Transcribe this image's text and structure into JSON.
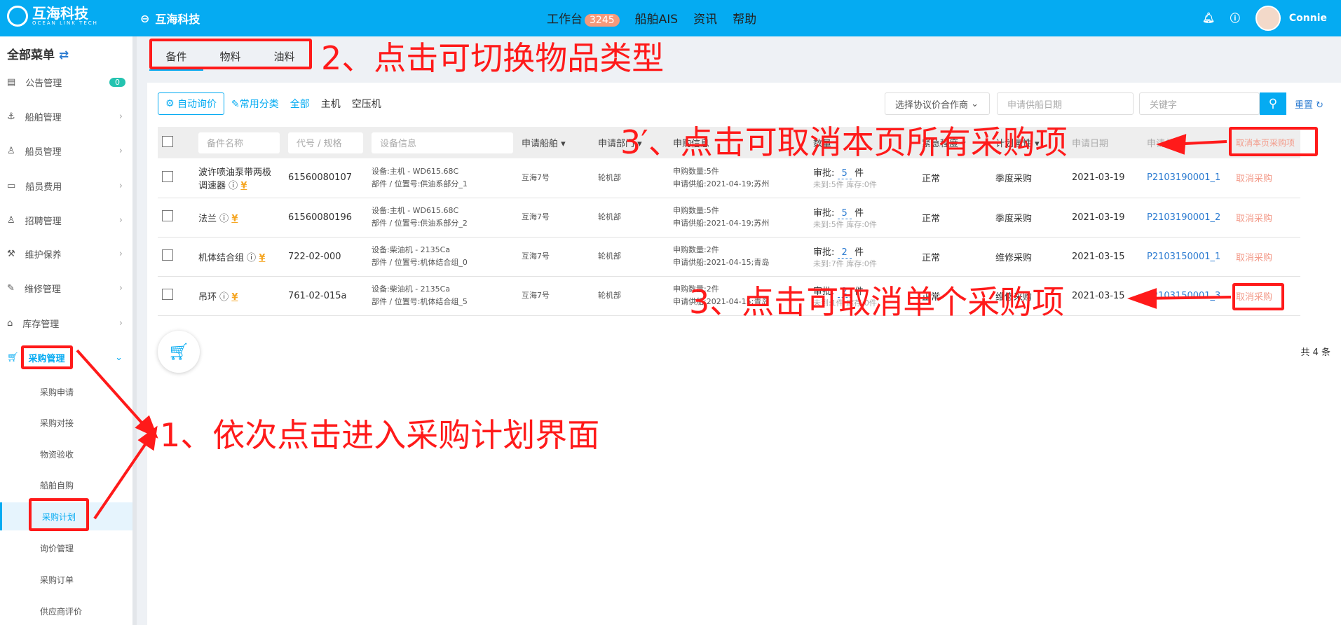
{
  "header": {
    "logo_cn": "互海科技",
    "logo_en": "OCEAN LINK TECH",
    "company": "互海科技",
    "nav": [
      {
        "label": "工作台",
        "badge": "3245"
      },
      {
        "label": "船舶AIS"
      },
      {
        "label": "资讯"
      },
      {
        "label": "帮助"
      }
    ],
    "user": "Connie"
  },
  "sidebar": {
    "title": "全部菜单",
    "items": [
      {
        "label": "公告管理",
        "count": "0"
      },
      {
        "label": "船舶管理"
      },
      {
        "label": "船员管理"
      },
      {
        "label": "船员费用"
      },
      {
        "label": "招聘管理"
      },
      {
        "label": "维护保养"
      },
      {
        "label": "维修管理"
      },
      {
        "label": "库存管理"
      },
      {
        "label": "采购管理"
      }
    ],
    "sub": [
      "采购申请",
      "采购对接",
      "物资验收",
      "船舶自购",
      "采购计划",
      "询价管理",
      "采购订单",
      "供应商评价"
    ]
  },
  "tabs": [
    "备件",
    "物料",
    "油料"
  ],
  "toolbar": {
    "auto": "自动询价",
    "common": "常用分类",
    "filters": [
      "全部",
      "主机",
      "空压机"
    ],
    "partner": "选择协议价合作商",
    "date_ph": "申请供船日期",
    "keyword_ph": "关键字",
    "reset": "重置"
  },
  "table": {
    "filters": [
      "备件名称",
      "代号 / 规格",
      "设备信息"
    ],
    "headers": [
      "申请船舶",
      "申请部门",
      "申购信息",
      "数量",
      "紧急程度",
      "计划属性",
      "申请日期",
      "申请单号"
    ],
    "cancel_all": "取消本页采购项",
    "rows": [
      {
        "name": "波许喷油泵带两极调速器",
        "code": "61560080107",
        "device": "设备:主机 - WD615.68C",
        "part": "部件 / 位置号:供油系部分_1",
        "ship": "互海7号",
        "dept": "轮机部",
        "qty_info": "申购数量:5件",
        "supply": "申请供船:2021-04-19;苏州",
        "approve": "5",
        "stock": "未到:5件 库存:0件",
        "urgency": "正常",
        "plan": "季度采购",
        "date": "2021-03-19",
        "no": "P2103190001_1",
        "action": "取消采购"
      },
      {
        "name": "法兰",
        "code": "61560080196",
        "device": "设备:主机 - WD615.68C",
        "part": "部件 / 位置号:供油系部分_2",
        "ship": "互海7号",
        "dept": "轮机部",
        "qty_info": "申购数量:5件",
        "supply": "申请供船:2021-04-19;苏州",
        "approve": "5",
        "stock": "未到:5件 库存:0件",
        "urgency": "正常",
        "plan": "季度采购",
        "date": "2021-03-19",
        "no": "P2103190001_2",
        "action": "取消采购"
      },
      {
        "name": "机体结合组",
        "code": "722-02-000",
        "device": "设备:柴油机 - 2135Ca",
        "part": "部件 / 位置号:机体结合组_0",
        "ship": "互海7号",
        "dept": "轮机部",
        "qty_info": "申购数量:2件",
        "supply": "申请供船:2021-04-15;青岛",
        "approve": "2",
        "stock": "未到:7件 库存:0件",
        "urgency": "正常",
        "plan": "维修采购",
        "date": "2021-03-15",
        "no": "P2103150001_1",
        "action": "取消采购"
      },
      {
        "name": "吊环",
        "code": "761-02-015a",
        "device": "设备:柴油机 - 2135Ca",
        "part": "部件 / 位置号:机体结合组_5",
        "ship": "互海7号",
        "dept": "轮机部",
        "qty_info": "申购数量:2件",
        "supply": "申请供船:2021-04-15;青岛",
        "approve": "2",
        "stock": "未到:1件 库存:0件",
        "urgency": "正常",
        "plan": "维修采购",
        "date": "2021-03-15",
        "no": "P2103150001_3",
        "action": "取消采购"
      }
    ],
    "approve_label": "审批:",
    "unit": "件",
    "total": "共 4 条"
  },
  "annotations": {
    "a1": "1、依次点击进入采购计划界面",
    "a2": "2、点击可切换物品类型",
    "a3p": "3′、点击可取消本页所有采购项",
    "a3": "3、点击可取消单个采购项",
    "color": "#ff1a1a"
  }
}
